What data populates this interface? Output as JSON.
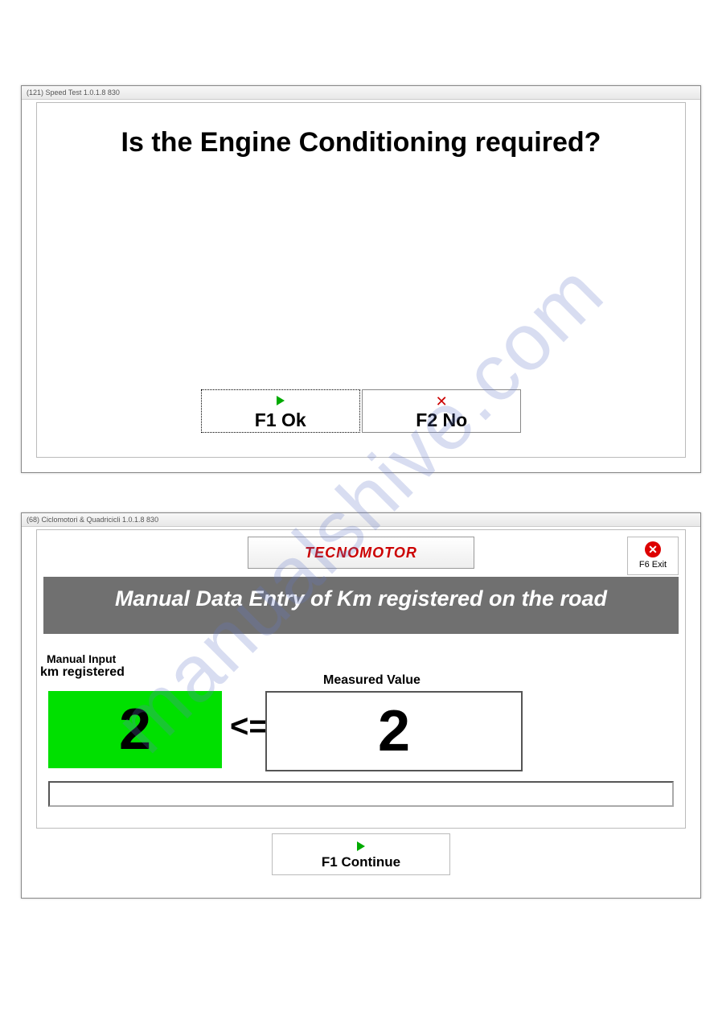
{
  "watermark": "manualshive.com",
  "window1": {
    "title": "(121) Speed Test 1.0.1.8  830",
    "question": "Is the Engine Conditioning required?",
    "ok_button": "F1 Ok",
    "no_button": "F2 No"
  },
  "window2": {
    "title": "(68) Ciclomotori & Quadricicli 1.0.1.8  830",
    "logo": "TECNOMOTOR",
    "exit_label": "F6 Exit",
    "banner": "Manual Data Entry of Km registered on the road",
    "manual_input_label": "Manual Input",
    "km_registered_label": "km registered",
    "limit_value": "2",
    "operator": "<=",
    "measured_label": "Measured Value",
    "measured_value": "2",
    "continue_button": "F1 Continue"
  }
}
